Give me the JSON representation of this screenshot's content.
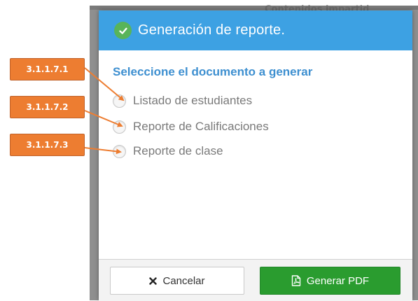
{
  "modal": {
    "title": "Generación de reporte.",
    "section_title": "Seleccione el documento a generar",
    "options": [
      {
        "label": "Listado de estudiantes"
      },
      {
        "label": "Reporte de Calificaciones"
      },
      {
        "label": "Reporte de clase"
      }
    ],
    "footer": {
      "cancel_label": "Cancelar",
      "generate_label": "Generar PDF"
    }
  },
  "background": {
    "ghost_text": "Contenidos impartid"
  },
  "callouts": [
    {
      "label": "3.1.1.7.1"
    },
    {
      "label": "3.1.1.7.2"
    },
    {
      "label": "3.1.1.7.3"
    }
  ],
  "colors": {
    "header": "#3da1e3",
    "section_title": "#3d8fd0",
    "generate_button": "#2a9c2f",
    "callout": "#ed7d31"
  },
  "icons": {
    "header": "check-circle-icon",
    "cancel": "close-icon",
    "generate": "pdf-file-icon"
  }
}
